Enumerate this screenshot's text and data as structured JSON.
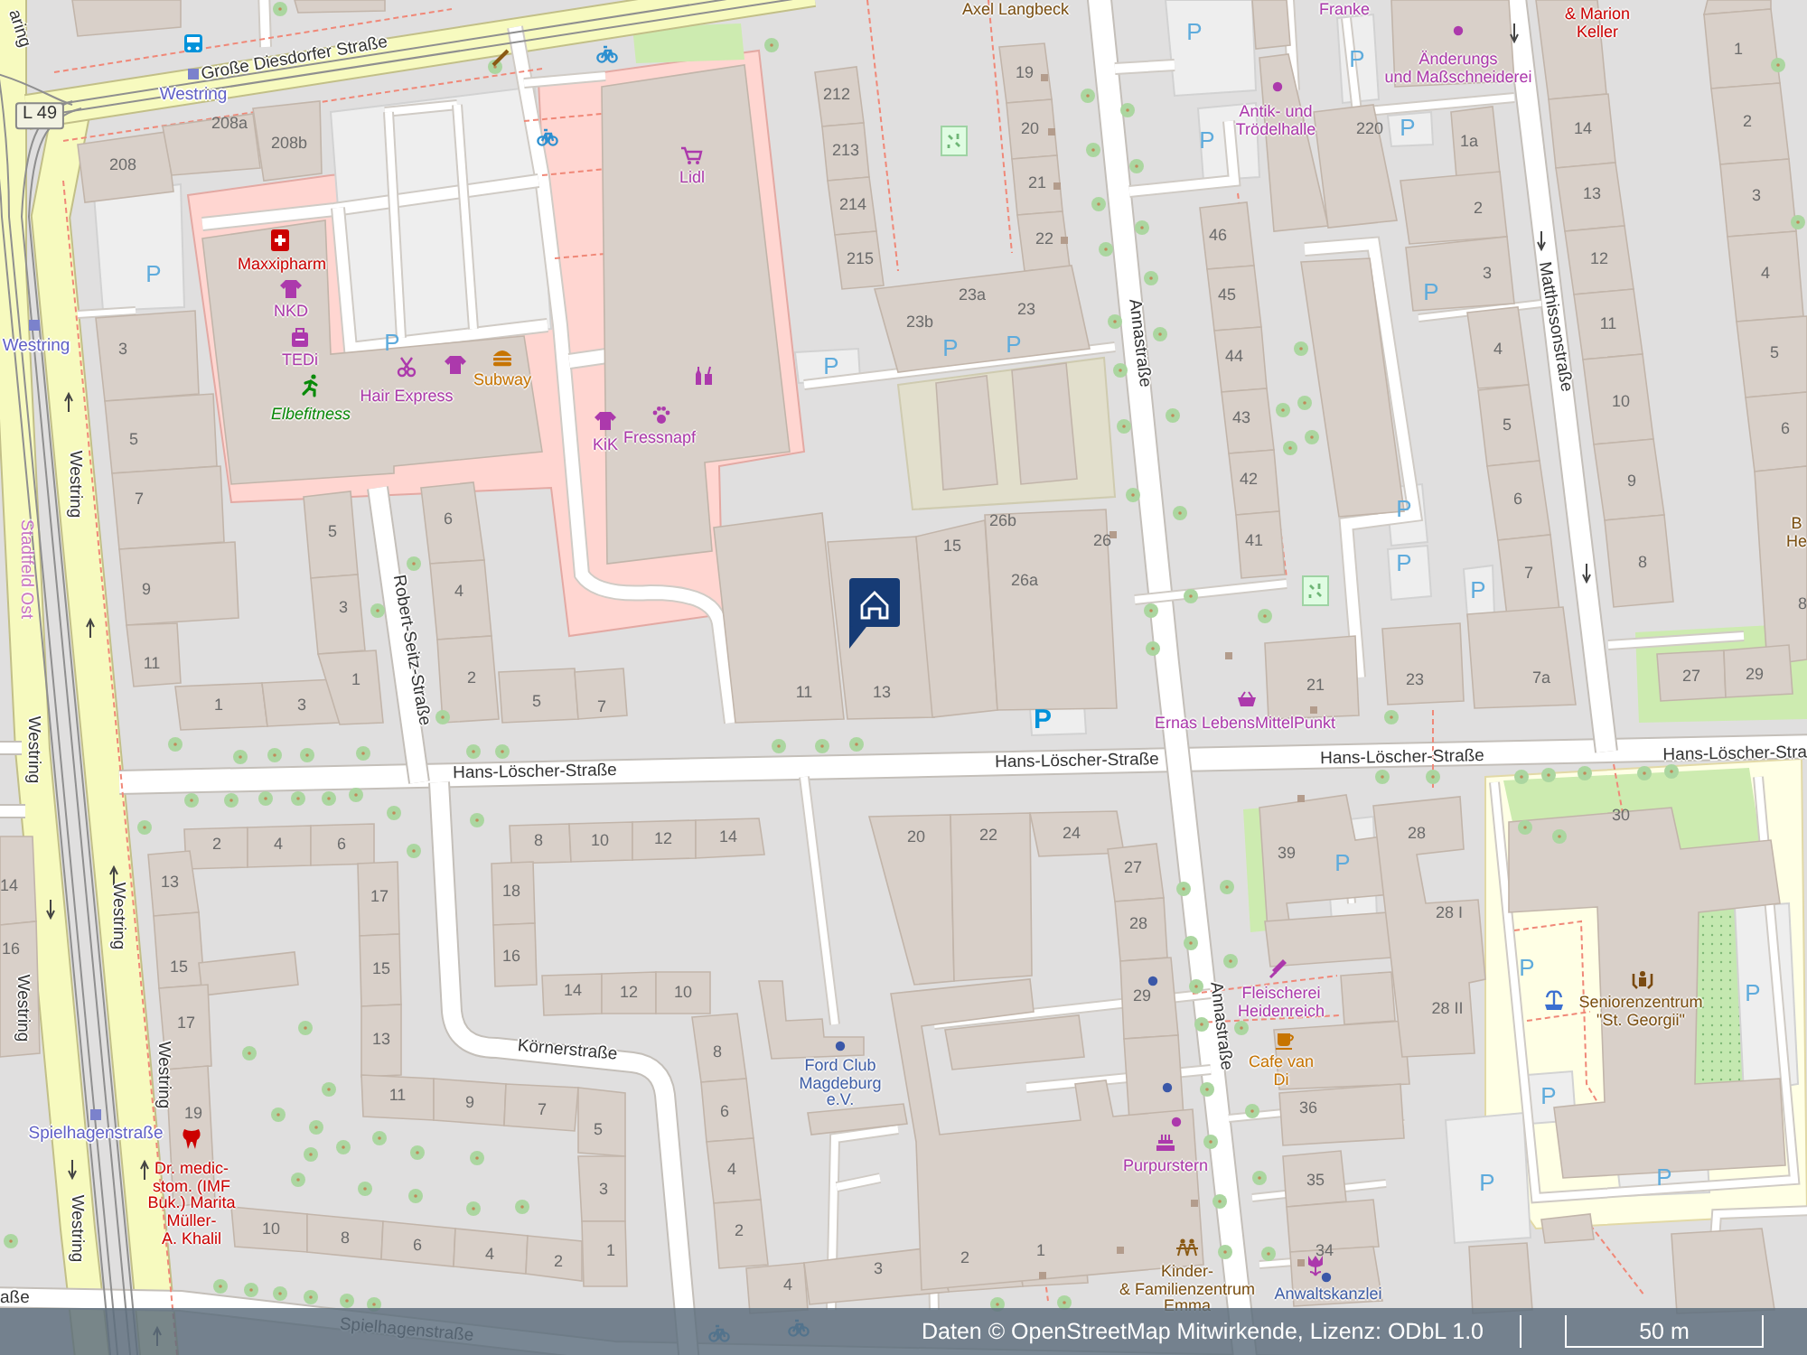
{
  "map": {
    "labels": [
      {
        "kind": "street",
        "text": "aring"
      },
      {
        "kind": "street",
        "text": "Große Diesdorfer Straße"
      },
      {
        "kind": "stop",
        "text": "Westring"
      },
      {
        "kind": "shield",
        "text": "L 49"
      },
      {
        "kind": "number",
        "text": "208a"
      },
      {
        "kind": "number",
        "text": "208b"
      },
      {
        "kind": "number",
        "text": "208"
      },
      {
        "kind": "parking",
        "text": "P"
      },
      {
        "kind": "stop",
        "text": "Westring"
      },
      {
        "kind": "number",
        "text": "3"
      },
      {
        "kind": "health",
        "text": "Maxxipharm"
      },
      {
        "kind": "shop",
        "text": "NKD"
      },
      {
        "kind": "shop",
        "text": "TEDi"
      },
      {
        "kind": "parking",
        "text": "P"
      },
      {
        "kind": "shop",
        "text": "Hair Express"
      },
      {
        "kind": "food",
        "text": "Subway"
      },
      {
        "kind": "leisure",
        "text": "Elbefitness"
      },
      {
        "kind": "number",
        "text": "5"
      },
      {
        "kind": "number",
        "text": "7"
      },
      {
        "kind": "street",
        "text": "Westring"
      },
      {
        "kind": "district",
        "text": "Stadtfeld Ost"
      },
      {
        "kind": "number",
        "text": "9"
      },
      {
        "kind": "number",
        "text": "11"
      },
      {
        "kind": "number",
        "text": "5"
      },
      {
        "kind": "number",
        "text": "3"
      },
      {
        "kind": "number",
        "text": "1"
      },
      {
        "kind": "street",
        "text": "Robert-Seitz-Straße"
      },
      {
        "kind": "number",
        "text": "6"
      },
      {
        "kind": "number",
        "text": "4"
      },
      {
        "kind": "number",
        "text": "2"
      },
      {
        "kind": "number",
        "text": "1"
      },
      {
        "kind": "number",
        "text": "3"
      },
      {
        "kind": "number",
        "text": "5"
      },
      {
        "kind": "number",
        "text": "7"
      },
      {
        "kind": "street",
        "text": "Westring"
      },
      {
        "kind": "street",
        "text": "Hans-Löscher-Straße"
      },
      {
        "kind": "street",
        "text": "Westring"
      },
      {
        "kind": "number",
        "text": "2"
      },
      {
        "kind": "number",
        "text": "4"
      },
      {
        "kind": "number",
        "text": "6"
      },
      {
        "kind": "number",
        "text": "14"
      },
      {
        "kind": "number",
        "text": "16"
      },
      {
        "kind": "street",
        "text": "Westring"
      },
      {
        "kind": "number",
        "text": "13"
      },
      {
        "kind": "number",
        "text": "15"
      },
      {
        "kind": "number",
        "text": "17"
      },
      {
        "kind": "number",
        "text": "19"
      },
      {
        "kind": "number",
        "text": "17"
      },
      {
        "kind": "number",
        "text": "15"
      },
      {
        "kind": "number",
        "text": "13"
      },
      {
        "kind": "number",
        "text": "11"
      },
      {
        "kind": "number",
        "text": "9"
      },
      {
        "kind": "number",
        "text": "7"
      },
      {
        "kind": "number",
        "text": "5"
      },
      {
        "kind": "number",
        "text": "3"
      },
      {
        "kind": "number",
        "text": "1"
      },
      {
        "kind": "street",
        "text": "Körnerstraße"
      },
      {
        "kind": "number",
        "text": "8"
      },
      {
        "kind": "number",
        "text": "10"
      },
      {
        "kind": "number",
        "text": "12"
      },
      {
        "kind": "number",
        "text": "14"
      },
      {
        "kind": "number",
        "text": "18"
      },
      {
        "kind": "number",
        "text": "16"
      },
      {
        "kind": "number",
        "text": "14"
      },
      {
        "kind": "number",
        "text": "12"
      },
      {
        "kind": "number",
        "text": "10"
      },
      {
        "kind": "stop",
        "text": "Spielhagenstraße"
      },
      {
        "kind": "street",
        "text": "Westring"
      },
      {
        "kind": "health",
        "text": "Dr. medic-\nstom. (IMF\nBuk.) Marita\nMüller-\nA. Khalil"
      },
      {
        "kind": "street",
        "text": "Westring"
      },
      {
        "kind": "number",
        "text": "10"
      },
      {
        "kind": "number",
        "text": "8"
      },
      {
        "kind": "number",
        "text": "6"
      },
      {
        "kind": "number",
        "text": "4"
      },
      {
        "kind": "number",
        "text": "2"
      },
      {
        "kind": "street",
        "text": "aße"
      },
      {
        "kind": "street",
        "text": "Spielhagenstraße"
      },
      {
        "kind": "community",
        "text": "Axel Langbeck"
      },
      {
        "kind": "number",
        "text": "212"
      },
      {
        "kind": "number",
        "text": "213"
      },
      {
        "kind": "number",
        "text": "214"
      },
      {
        "kind": "number",
        "text": "215"
      },
      {
        "kind": "shop",
        "text": "Lidl"
      },
      {
        "kind": "number",
        "text": "19"
      },
      {
        "kind": "number",
        "text": "20"
      },
      {
        "kind": "number",
        "text": "21"
      },
      {
        "kind": "number",
        "text": "22"
      },
      {
        "kind": "number",
        "text": "23a"
      },
      {
        "kind": "number",
        "text": "23b"
      },
      {
        "kind": "number",
        "text": "23"
      },
      {
        "kind": "parking",
        "text": "P"
      },
      {
        "kind": "parking",
        "text": "P"
      },
      {
        "kind": "parking",
        "text": "P"
      },
      {
        "kind": "shop",
        "text": "KiK"
      },
      {
        "kind": "shop",
        "text": "Fressnapf"
      },
      {
        "kind": "number",
        "text": "15"
      },
      {
        "kind": "number",
        "text": "26b"
      },
      {
        "kind": "number",
        "text": "26"
      },
      {
        "kind": "number",
        "text": "26a"
      },
      {
        "kind": "street",
        "text": "Annastraße"
      },
      {
        "kind": "parking",
        "text": "P"
      },
      {
        "kind": "parking",
        "text": "P"
      },
      {
        "kind": "shop",
        "text": "Franke"
      },
      {
        "kind": "shop",
        "text": "Änderungs\nund Maßschneiderei"
      },
      {
        "kind": "shop",
        "text": "Antik- und\nTrödelhalle"
      },
      {
        "kind": "health",
        "text": "& Marion\nKeller"
      },
      {
        "kind": "number",
        "text": "220"
      },
      {
        "kind": "parking",
        "text": "P"
      },
      {
        "kind": "number",
        "text": "1a"
      },
      {
        "kind": "number",
        "text": "2"
      },
      {
        "kind": "number",
        "text": "3"
      },
      {
        "kind": "number",
        "text": "4"
      },
      {
        "kind": "number",
        "text": "5"
      },
      {
        "kind": "number",
        "text": "6"
      },
      {
        "kind": "number",
        "text": "7"
      },
      {
        "kind": "number",
        "text": "7a"
      },
      {
        "kind": "parking",
        "text": "P"
      },
      {
        "kind": "parking",
        "text": "P"
      },
      {
        "kind": "parking",
        "text": "P"
      },
      {
        "kind": "parking",
        "text": "P"
      },
      {
        "kind": "parking",
        "text": "P"
      },
      {
        "kind": "number",
        "text": "46"
      },
      {
        "kind": "number",
        "text": "45"
      },
      {
        "kind": "number",
        "text": "44"
      },
      {
        "kind": "number",
        "text": "43"
      },
      {
        "kind": "number",
        "text": "42"
      },
      {
        "kind": "number",
        "text": "41"
      },
      {
        "kind": "street",
        "text": "Matthissonstraße"
      },
      {
        "kind": "number",
        "text": "14"
      },
      {
        "kind": "number",
        "text": "13"
      },
      {
        "kind": "number",
        "text": "12"
      },
      {
        "kind": "number",
        "text": "11"
      },
      {
        "kind": "number",
        "text": "10"
      },
      {
        "kind": "number",
        "text": "9"
      },
      {
        "kind": "number",
        "text": "8"
      },
      {
        "kind": "number",
        "text": "1"
      },
      {
        "kind": "number",
        "text": "2"
      },
      {
        "kind": "number",
        "text": "3"
      },
      {
        "kind": "number",
        "text": "4"
      },
      {
        "kind": "number",
        "text": "5"
      },
      {
        "kind": "number",
        "text": "6"
      },
      {
        "kind": "community",
        "text": "B\nHe"
      },
      {
        "kind": "number",
        "text": "8"
      },
      {
        "kind": "number",
        "text": "21"
      },
      {
        "kind": "number",
        "text": "23"
      },
      {
        "kind": "number",
        "text": "27"
      },
      {
        "kind": "number",
        "text": "29"
      },
      {
        "kind": "shop",
        "text": "Ernas LebensMittelPunkt"
      },
      {
        "kind": "street",
        "text": "Hans-Löscher-Straße"
      },
      {
        "kind": "street",
        "text": "Hans-Löscher-Straße"
      },
      {
        "kind": "street",
        "text": "Hans-Löscher-Stra"
      },
      {
        "kind": "number",
        "text": "11"
      },
      {
        "kind": "number",
        "text": "13"
      },
      {
        "kind": "parking_strong",
        "text": "P"
      },
      {
        "kind": "number",
        "text": "20"
      },
      {
        "kind": "number",
        "text": "22"
      },
      {
        "kind": "number",
        "text": "24"
      },
      {
        "kind": "number",
        "text": "27"
      },
      {
        "kind": "number",
        "text": "28"
      },
      {
        "kind": "number",
        "text": "29"
      },
      {
        "kind": "number",
        "text": "8"
      },
      {
        "kind": "number",
        "text": "6"
      },
      {
        "kind": "number",
        "text": "4"
      },
      {
        "kind": "number",
        "text": "2"
      },
      {
        "kind": "number",
        "text": "4"
      },
      {
        "kind": "number",
        "text": "3"
      },
      {
        "kind": "number",
        "text": "2"
      },
      {
        "kind": "number",
        "text": "1"
      },
      {
        "kind": "club",
        "text": "Ford Club\nMagdeburg\ne.V."
      },
      {
        "kind": "shop",
        "text": "Purpurstern"
      },
      {
        "kind": "community",
        "text": "Kinder-\n& Familienzentrum\nEmma"
      },
      {
        "kind": "number",
        "text": "39"
      },
      {
        "kind": "number",
        "text": "28"
      },
      {
        "kind": "number",
        "text": "28 I"
      },
      {
        "kind": "number",
        "text": "28 II"
      },
      {
        "kind": "number",
        "text": "30"
      },
      {
        "kind": "parking",
        "text": "P"
      },
      {
        "kind": "parking",
        "text": "P"
      },
      {
        "kind": "parking",
        "text": "P"
      },
      {
        "kind": "parking",
        "text": "P"
      },
      {
        "kind": "parking",
        "text": "P"
      },
      {
        "kind": "parking",
        "text": "P"
      },
      {
        "kind": "shop",
        "text": "Fleischerei\nHeidenreich"
      },
      {
        "kind": "street",
        "text": "Annastraße"
      },
      {
        "kind": "food",
        "text": "Cafe van\nDi"
      },
      {
        "kind": "number",
        "text": "36"
      },
      {
        "kind": "number",
        "text": "35"
      },
      {
        "kind": "number",
        "text": "34"
      },
      {
        "kind": "community",
        "text": "Seniorenzentrum\n\"St. Georgii\""
      },
      {
        "kind": "club",
        "text": "Anwaltskanzlei"
      }
    ]
  },
  "attribution": {
    "text": "Daten © OpenStreetMap Mitwirkende, Lizenz: ODbL 1.0",
    "scale": "50 m"
  }
}
